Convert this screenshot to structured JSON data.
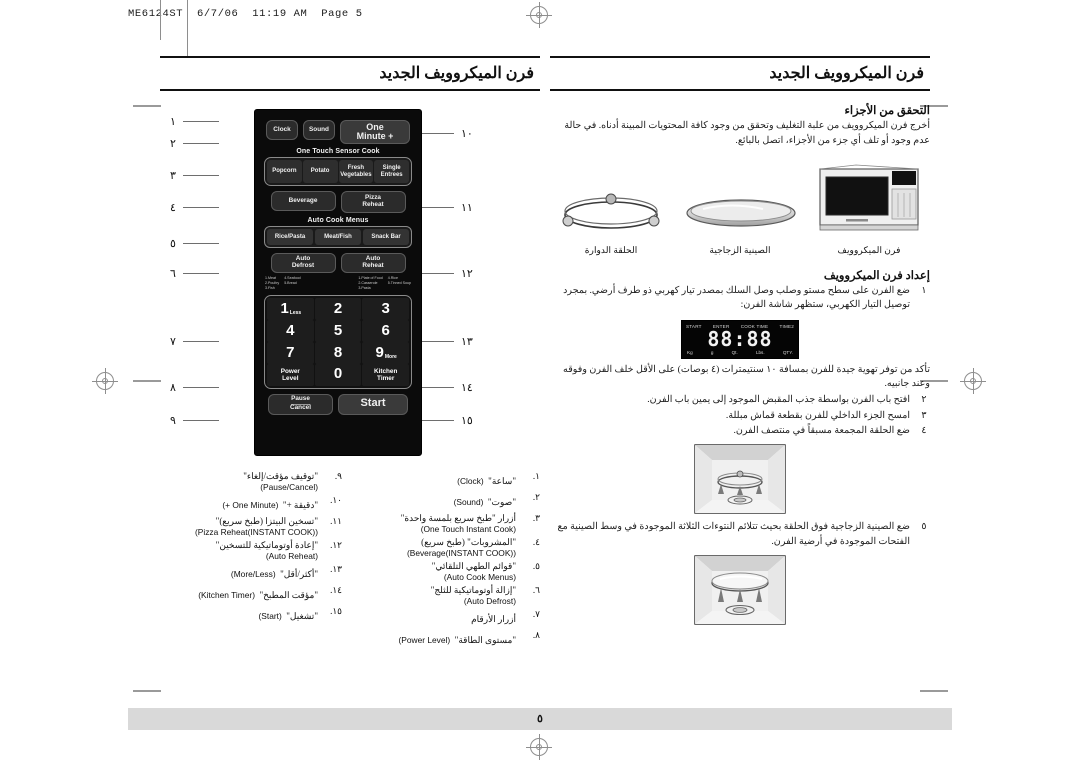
{
  "proof": {
    "header": "ME6124ST  6/7/06  11:19 AM  Page 5"
  },
  "footer": {
    "page_number": "٥"
  },
  "column_right": {
    "title": "فرن الميكروويف الجديد",
    "check_parts": {
      "heading": "التحقق من الأجزاء",
      "body": "أخرج فرن الميكروويف من علبة التغليف وتحقق من وجود كافة المحتويات المبينة أدناه. في حالة عدم وجود أو تلف أي جزء من الأجزاء، اتصل بالبائع."
    },
    "parts": [
      {
        "caption": "الحلقة الدوارة",
        "icon": "roller-ring-illustration"
      },
      {
        "caption": "الصينية الزجاجية",
        "icon": "glass-tray-illustration"
      },
      {
        "caption": "فرن الميكروويف",
        "icon": "microwave-oven-illustration"
      }
    ],
    "setup": {
      "heading": "إعداد فرن الميكروويف",
      "steps": [
        {
          "num": "١",
          "text": "ضع الفرن على سطح مستو وصلب وصل السلك بمصدر تيار كهربي ذو طرف أرضي. بمجرد توصيل التيار الكهربي، ستظهر شاشة الفرن:"
        },
        {
          "num": "",
          "text": "تأكد من توفر تهوية جيدة للفرن بمسافة ١٠ سنتيمترات (٤ بوصات) على الأقل خلف الفرن وفوقه وعند جانبيه."
        },
        {
          "num": "٢",
          "text": "افتح باب الفرن بواسطة جذب المقبض الموجود إلى يمين باب الفرن."
        },
        {
          "num": "٣",
          "text": "امسح الجزء الداخلي للفرن بقطعة قماش مبللة."
        },
        {
          "num": "٤",
          "text": "ضع الحلقة المجمعة مسبقاً في منتصف الفرن."
        },
        {
          "num": "٥",
          "text": "ضع الصينية الزجاجية فوق الحلقة بحيث تتلائم النتوءات الثلاثة الموجودة في وسط الصينية مع الفتحات الموجودة في أرضية الفرن."
        }
      ]
    },
    "display": {
      "top_labels": [
        "START",
        "ENTER",
        "COOK TIME",
        "TIME2"
      ],
      "digits": "88:88",
      "bottom_labels": [
        "Kg",
        "g",
        "Qt.",
        "Lbs.",
        "QTY."
      ]
    },
    "oven_illustrations": [
      {
        "name": "oven-with-roller-ring"
      },
      {
        "name": "oven-with-glass-tray"
      }
    ]
  },
  "column_left": {
    "title": "فرن الميكروويف الجديد",
    "panel": {
      "clock": "Clock",
      "sound": "Sound",
      "one_minute": [
        "One",
        "Minute +"
      ],
      "sensor_group_label": "One Touch Sensor Cook",
      "sensor_buttons": [
        {
          "lines": [
            "Popcorn"
          ]
        },
        {
          "lines": [
            "Potato"
          ]
        },
        {
          "lines": [
            "Fresh",
            "Vegetables"
          ]
        },
        {
          "lines": [
            "Single",
            "Entrees"
          ]
        }
      ],
      "beverage": "Beverage",
      "pizza_reheat": [
        "Pizza",
        "Reheat"
      ],
      "auto_cook_label": "Auto Cook Menus",
      "auto_cook_buttons": [
        "Rice/Pasta",
        "Meat/Fish",
        "Snack Bar"
      ],
      "auto_defrost": [
        "Auto",
        "Defrost"
      ],
      "auto_reheat": [
        "Auto",
        "Reheat"
      ],
      "defrost_menu": [
        "1.Meat",
        "4.Seafood",
        "2.Poultry",
        "5.Bread",
        "3.Fish"
      ],
      "reheat_menu": [
        "1.Plate of Food",
        "4.Rice",
        "2.Casserole",
        "5.Tinned Soup",
        "3.Pasta"
      ],
      "keys": [
        {
          "label": "1",
          "sub": "Less"
        },
        {
          "label": "2",
          "sub": ""
        },
        {
          "label": "3",
          "sub": ""
        },
        {
          "label": "4",
          "sub": ""
        },
        {
          "label": "5",
          "sub": ""
        },
        {
          "label": "6",
          "sub": ""
        },
        {
          "label": "7",
          "sub": ""
        },
        {
          "label": "8",
          "sub": ""
        },
        {
          "label": "9",
          "sub": "More"
        }
      ],
      "power_level": [
        "Power",
        "Level"
      ],
      "zero": "0",
      "kitchen_timer": [
        "Kitchen",
        "Timer"
      ],
      "pause_cancel": [
        "Pause",
        "Cancel"
      ],
      "start": "Start"
    },
    "callouts_left": [
      "١",
      "٢",
      "٣",
      "٤",
      "٥",
      "٦",
      "٧",
      "٨",
      "٩"
    ],
    "callouts_right": [
      "١٠",
      "١١",
      "١٢",
      "١٣",
      "١٤",
      "١٥"
    ],
    "legend_right_col": [
      {
        "num": "١.",
        "ar": "\"ساعة\"",
        "en": "(Clock)"
      },
      {
        "num": "٢.",
        "ar": "\"صوت\"",
        "en": "(Sound)"
      },
      {
        "num": "٣.",
        "ar": "أزرار \"طبخ سريع بلمسة واحدة\"",
        "en": "(One Touch Instant Cook)"
      },
      {
        "num": "٤.",
        "ar": "\"المشروبات\" (طبخ سريع)",
        "en": "(Beverage(INSTANT COOK))"
      },
      {
        "num": "٥.",
        "ar": "\"قوائم الطهي التلقائي\"",
        "en": "(Auto Cook Menus)"
      },
      {
        "num": "٦.",
        "ar": "\"إزالة أوتوماتيكية للثلج\"",
        "en": "(Auto Defrost)"
      },
      {
        "num": "٧.",
        "ar": "أزرار الأرقام",
        "en": ""
      },
      {
        "num": "٨.",
        "ar": "\"مستوى الطاقة\"",
        "en": "(Power Level)"
      }
    ],
    "legend_left_col": [
      {
        "num": "٩.",
        "ar": "\"توقيف مؤقت/إلغاء\"",
        "en": "(Pause/Cancel)"
      },
      {
        "num": "١٠.",
        "ar": "\"دقيقة +\"",
        "en": "(One Minute +)"
      },
      {
        "num": "١١.",
        "ar": "\"تسخين البيتزا (طبخ سريع)\"",
        "en": "(Pizza Reheat(INSTANT COOK))"
      },
      {
        "num": "١٢.",
        "ar": "\"إعادة أوتوماتيكية للتسخين\"",
        "en": "(Auto Reheat)"
      },
      {
        "num": "١٣.",
        "ar": "\"أكثر/أقل\"",
        "en": "(More/Less)"
      },
      {
        "num": "١٤.",
        "ar": "\"مؤقت المطبخ\"",
        "en": "(Kitchen Timer)"
      },
      {
        "num": "١٥.",
        "ar": "\"تشغيل\"",
        "en": "(Start)"
      }
    ]
  }
}
